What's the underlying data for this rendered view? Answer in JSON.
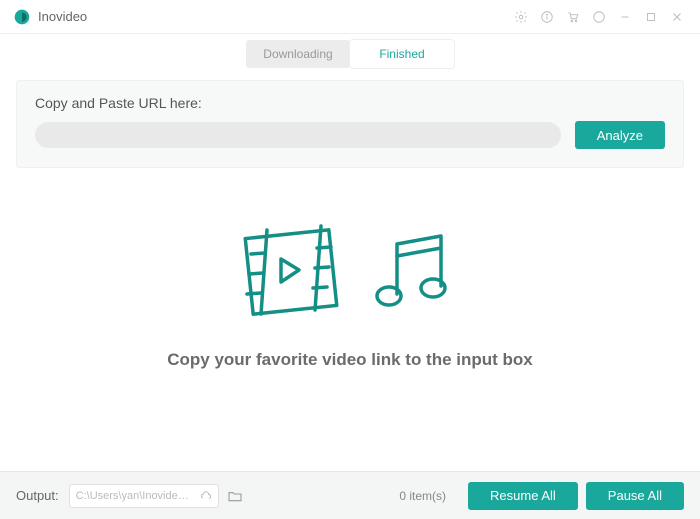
{
  "app": {
    "name": "Inovideo"
  },
  "tabs": {
    "downloading": "Downloading",
    "finished": "Finished",
    "active": "finished"
  },
  "url_panel": {
    "label": "Copy and Paste URL here:",
    "input_value": "",
    "analyze": "Analyze"
  },
  "empty_state": {
    "message": "Copy your favorite video link to the input box"
  },
  "footer": {
    "output_label": "Output:",
    "output_path": "C:\\Users\\yan\\Inovideo\\D...",
    "item_count": "0 item(s)",
    "resume_all": "Resume All",
    "pause_all": "Pause All"
  },
  "colors": {
    "accent": "#1aa89c"
  }
}
